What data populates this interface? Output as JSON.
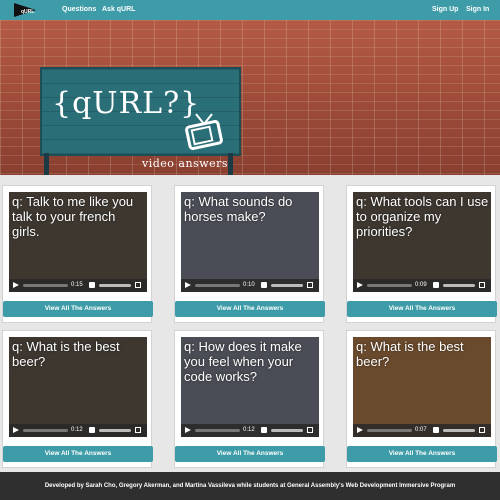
{
  "nav": {
    "logo_text": "qURL",
    "links": [
      "Questions",
      "Ask qURL"
    ],
    "right_links": [
      "Sign Up",
      "Sign In"
    ]
  },
  "hero": {
    "brand": "{qURL?}",
    "tagline": "video answers"
  },
  "cards": [
    {
      "question": "q: Talk to me like you talk to your french girls.",
      "time": "0:15",
      "button": "View All The Answers"
    },
    {
      "question": "q: What sounds do horses make?",
      "time": "0:10",
      "button": "View All The Answers"
    },
    {
      "question": "q: What tools can I use to organize my priorities?",
      "time": "0:09",
      "button": "View All The Answers"
    },
    {
      "question": "q: What is the best beer?",
      "time": "0:12",
      "button": "View All The Answers"
    },
    {
      "question": "q: How does it make you feel when your code works?",
      "time": "0:12",
      "button": "View All The Answers"
    },
    {
      "question": "q: What is the best beer?",
      "time": "0:07",
      "button": "View All The Answers"
    }
  ],
  "footer": {
    "text": "Developed by Sarah Cho, Gregory Akerman, and Martina Vassileva while students at General Assembly's Web Development Immersive Program"
  },
  "colors": {
    "accent": "#3e9ca8",
    "footer": "#2f2f2f"
  },
  "icons": [
    "tv-icon",
    "play-icon",
    "volume-icon",
    "fullscreen-icon"
  ]
}
